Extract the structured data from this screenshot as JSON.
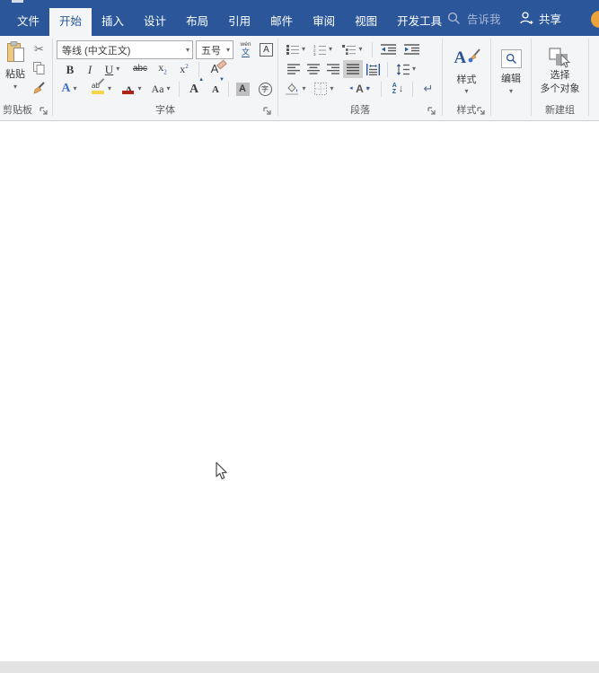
{
  "colors": {
    "titlebar_blue": "#2B579A",
    "ribbon_bg": "#F4F5F7",
    "accent_blue": "#2B579A",
    "highlight_yellow": "#F7D44C",
    "font_color_red": "#B02418",
    "status_bar_gray": "#E3E3E4",
    "avatar_orange": "#EDA33C"
  },
  "titlebar": {
    "tabs": [
      {
        "label": "文件"
      },
      {
        "label": "开始"
      },
      {
        "label": "插入"
      },
      {
        "label": "设计"
      },
      {
        "label": "布局"
      },
      {
        "label": "引用"
      },
      {
        "label": "邮件"
      },
      {
        "label": "审阅"
      },
      {
        "label": "视图"
      },
      {
        "label": "开发工具"
      }
    ],
    "selected_tab": "开始",
    "tell_me": "告诉我",
    "share": "共享"
  },
  "ribbon": {
    "clipboard": {
      "group_label": "剪贴板",
      "paste_label": "粘贴"
    },
    "font": {
      "group_label": "字体",
      "font_name": "等线 (中文正文)",
      "font_size": "五号",
      "phonetic_top": "wén",
      "phonetic_bottom": "文",
      "char_border_glyph": "A",
      "bold_glyph": "B",
      "italic_glyph": "I",
      "underline_glyph": "U",
      "strikethrough_glyph": "abc",
      "subscript_glyph": "x",
      "subscript_mark": "2",
      "superscript_glyph": "x",
      "superscript_mark": "2",
      "clear_format_glyph": "A",
      "text_effects_glyph": "A",
      "highlight_glyph": "ab",
      "font_color_glyph": "A",
      "change_case_glyph": "Aa",
      "grow_font_glyph": "A",
      "shrink_font_glyph": "A",
      "char_shading_glyph": "A",
      "enclose_glyph": "字"
    },
    "paragraph": {
      "group_label": "段落",
      "numbering_digits": [
        "1",
        "2",
        "3"
      ],
      "asian_layout_glyph": "A",
      "sort_a": "A",
      "sort_z": "Z",
      "show_marks_glyph": "↵"
    },
    "styles": {
      "group_label": "样式",
      "button_label": "样式",
      "icon_glyph": "A"
    },
    "editing": {
      "button_label": "编辑"
    },
    "new_group": {
      "group_label": "新建组",
      "select_label_line1": "选择",
      "select_label_line2": "多个对象"
    }
  }
}
